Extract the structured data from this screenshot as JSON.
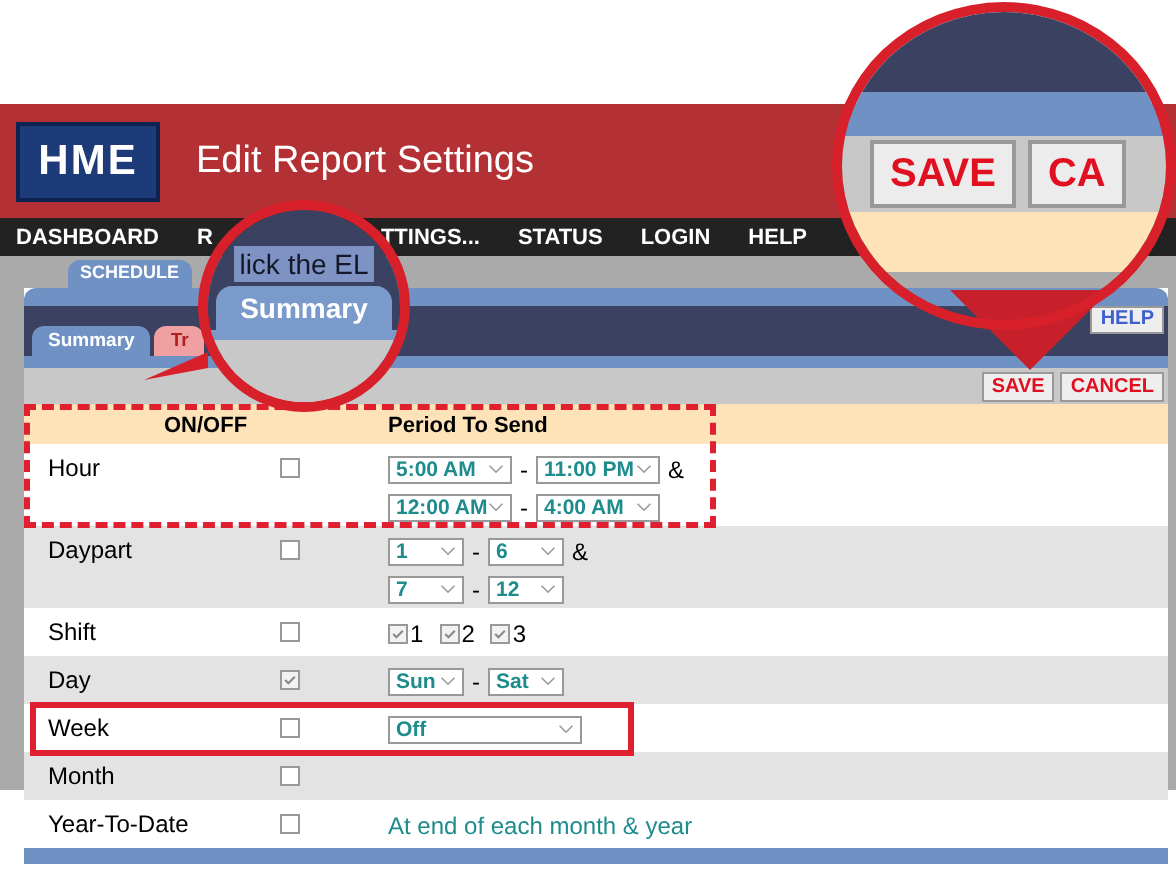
{
  "header": {
    "logo": "HME",
    "title": "Edit Report Settings"
  },
  "nav": [
    {
      "label": "DASHBOARD"
    },
    {
      "label": "R"
    },
    {
      "label": "TTINGS..."
    },
    {
      "label": "STATUS"
    },
    {
      "label": "LOGIN"
    },
    {
      "label": "HELP"
    }
  ],
  "top_tabs": [
    {
      "label": "SCHEDULE",
      "selected": true
    }
  ],
  "help_button": "HELP",
  "sub_tabs": [
    {
      "label": "Summary",
      "selected": true
    },
    {
      "label": "Tr",
      "selected": false
    }
  ],
  "actions": [
    "SAVE",
    "CANCEL"
  ],
  "table": {
    "columns": [
      "ON/OFF",
      "Period To Send"
    ],
    "rows": [
      {
        "label": "Hour",
        "kind": "range",
        "on": false,
        "ranges": [
          {
            "from": "5:00 AM",
            "sep": "-",
            "to": "11:00 PM",
            "and": "&"
          },
          {
            "from": "12:00 AM",
            "sep": "-",
            "to": "4:00 AM"
          }
        ]
      },
      {
        "label": "Daypart",
        "kind": "range",
        "on": false,
        "ranges": [
          {
            "from": "1",
            "sep": "-",
            "to": "6",
            "and": "&"
          },
          {
            "from": "7",
            "sep": "-",
            "to": "12"
          }
        ]
      },
      {
        "label": "Shift",
        "kind": "shifts",
        "on": false,
        "shifts": [
          {
            "label": "1",
            "checked": true
          },
          {
            "label": "2",
            "checked": true
          },
          {
            "label": "3",
            "checked": true
          }
        ]
      },
      {
        "label": "Day",
        "kind": "range",
        "on": true,
        "ranges": [
          {
            "from": "Sun",
            "sep": "-",
            "to": "Sat"
          }
        ]
      },
      {
        "label": "Week",
        "kind": "select",
        "on": false,
        "value": "Off"
      },
      {
        "label": "Month",
        "kind": "none",
        "on": false
      },
      {
        "label": "Year-To-Date",
        "kind": "text",
        "on": false,
        "text": "At end of each month & year"
      }
    ]
  },
  "magnifiers": [
    {
      "caption": "lick the EL",
      "tab": "Summary"
    },
    {
      "buttons": [
        "SAVE",
        "CA"
      ]
    }
  ]
}
